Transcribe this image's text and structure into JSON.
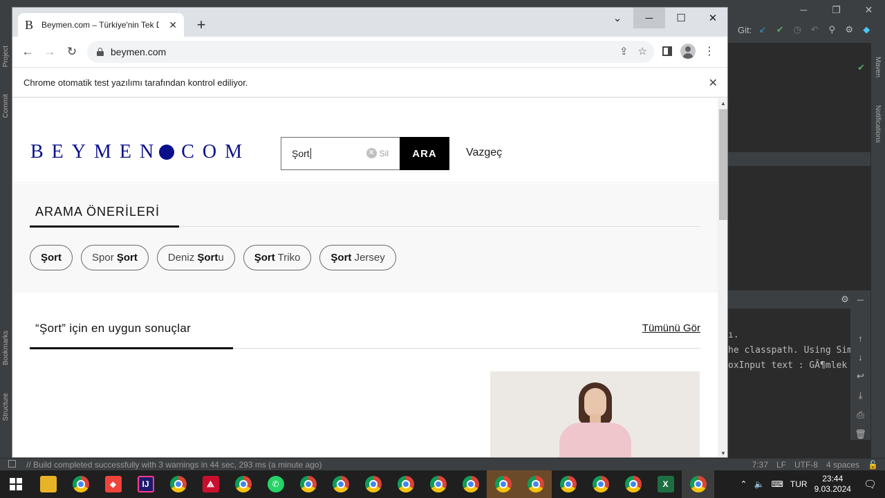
{
  "ide": {
    "git_label": "Git:",
    "left_tools": [
      "Project",
      "Commit",
      "Bookmarks",
      "Structure"
    ],
    "right_tools": [
      "Maven",
      "Notifications"
    ],
    "console_lines": [
      "ı.",
      "",
      "he classpath. Using Sim",
      "oxInput text : GÃ¶mlek"
    ],
    "status_message": "// Build completed successfully with 3 warnings in 44 sec, 293 ms (a minute ago)",
    "status_right": [
      "7:37",
      "LF",
      "UTF-8",
      "4 spaces"
    ]
  },
  "browser": {
    "tab_favicon": "B",
    "tab_title": "Beymen.com – Türkiye'nin Tek D",
    "url": "beymen.com",
    "infobar_text": "Chrome otomatik test yazılımı tarafından kontrol ediliyor."
  },
  "page": {
    "logo_left": "BEYMEN",
    "logo_right": "COM",
    "search_value": "Şort",
    "clear_label": "Sil",
    "search_button": "ARA",
    "cancel_label": "Vazgeç",
    "suggestions_title": "ARAMA ÖNERİLERİ",
    "suggestions": [
      {
        "pre": "",
        "bold": "Şort",
        "post": ""
      },
      {
        "pre": "Spor ",
        "bold": "Şort",
        "post": ""
      },
      {
        "pre": "Deniz ",
        "bold": "Şort",
        "post": "u"
      },
      {
        "pre": "",
        "bold": "Şort",
        "post": " Triko"
      },
      {
        "pre": "",
        "bold": "Şort",
        "post": " Jersey"
      }
    ],
    "results_title": "“Şort” için en uygun sonuçlar",
    "see_all": "Tümünü Gör"
  },
  "taskbar": {
    "language": "TUR",
    "time": "23:44",
    "date": "9.03.2024"
  }
}
